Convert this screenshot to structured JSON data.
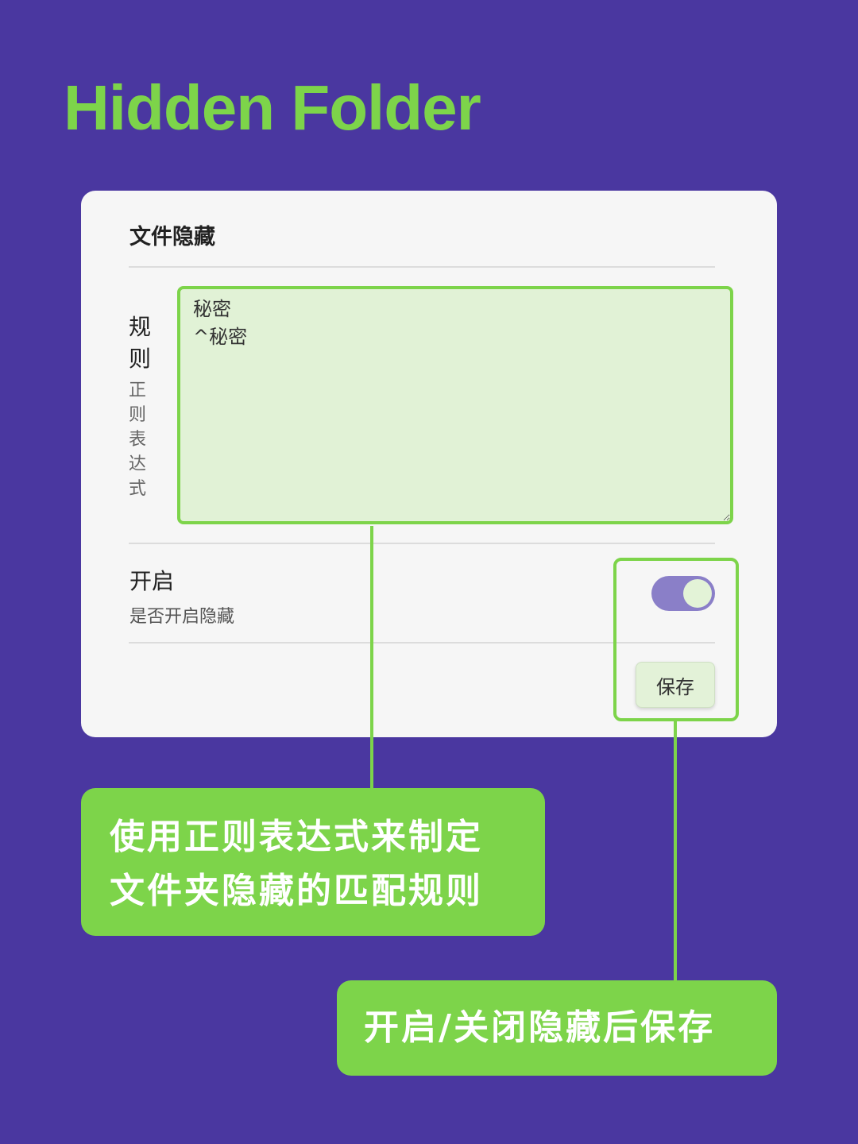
{
  "page": {
    "title": "Hidden Folder"
  },
  "panel": {
    "section_title": "文件隐藏",
    "rule": {
      "label": "规则",
      "description": "正则表达式",
      "value": "秘密\n^秘密"
    },
    "enable": {
      "label": "开启",
      "description": "是否开启隐藏",
      "toggle_on": true
    },
    "save_label": "保存"
  },
  "callouts": {
    "regex": {
      "line1": "使用正则表达式来制定",
      "line2": "文件夹隐藏的匹配规则"
    },
    "save": {
      "text": "开启/关闭隐藏后保存"
    }
  },
  "colors": {
    "background": "#4a37a0",
    "accent": "#7dd44a",
    "toggle_track": "#8a7fc8",
    "panel": "#f6f6f6"
  }
}
